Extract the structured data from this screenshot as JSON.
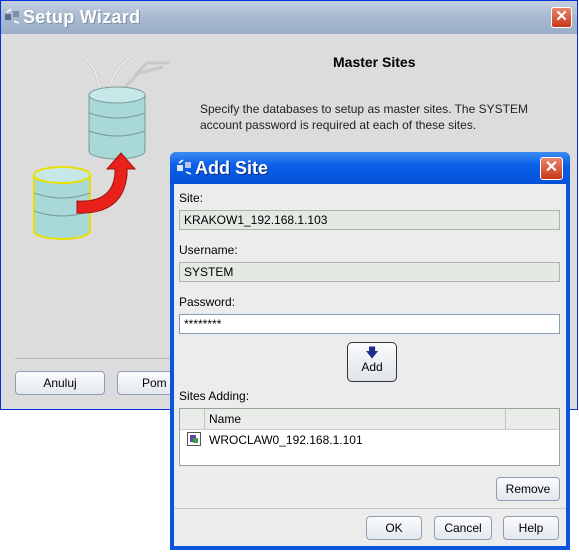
{
  "wizard": {
    "title": "Setup Wizard",
    "heading": "Master Sites",
    "description": "Specify the databases to setup as master sites. The SYSTEM account password is required at each of these sites.",
    "buttons": {
      "cancel": "Anuluj",
      "help_partial": "Pom"
    }
  },
  "dialog": {
    "title": "Add Site",
    "site_label": "Site:",
    "site_value": "KRAKOW1_192.168.1.103",
    "username_label": "Username:",
    "username_value": "SYSTEM",
    "password_label": "Password:",
    "password_value": "********",
    "add_label": "Add",
    "sites_adding_label": "Sites Adding:",
    "table": {
      "columns": [
        "Name"
      ],
      "rows": [
        {
          "name": "WROCLAW0_192.168.1.101",
          "icon": "database-site-icon"
        }
      ]
    },
    "remove_label": "Remove",
    "ok_label": "OK",
    "cancel_label": "Cancel",
    "help_label": "Help"
  },
  "icons": {
    "close": "close-icon",
    "app": "oracle-app-icon",
    "add_arrow": "arrow-down-icon"
  },
  "colors": {
    "dialog_titlebar": "#0a5fe8",
    "wizard_titlebar_inactive": "#a8b9d0",
    "close_button": "#c9371a",
    "database_fill": "#a8d8d8",
    "arrow_red": "#e8221a"
  }
}
